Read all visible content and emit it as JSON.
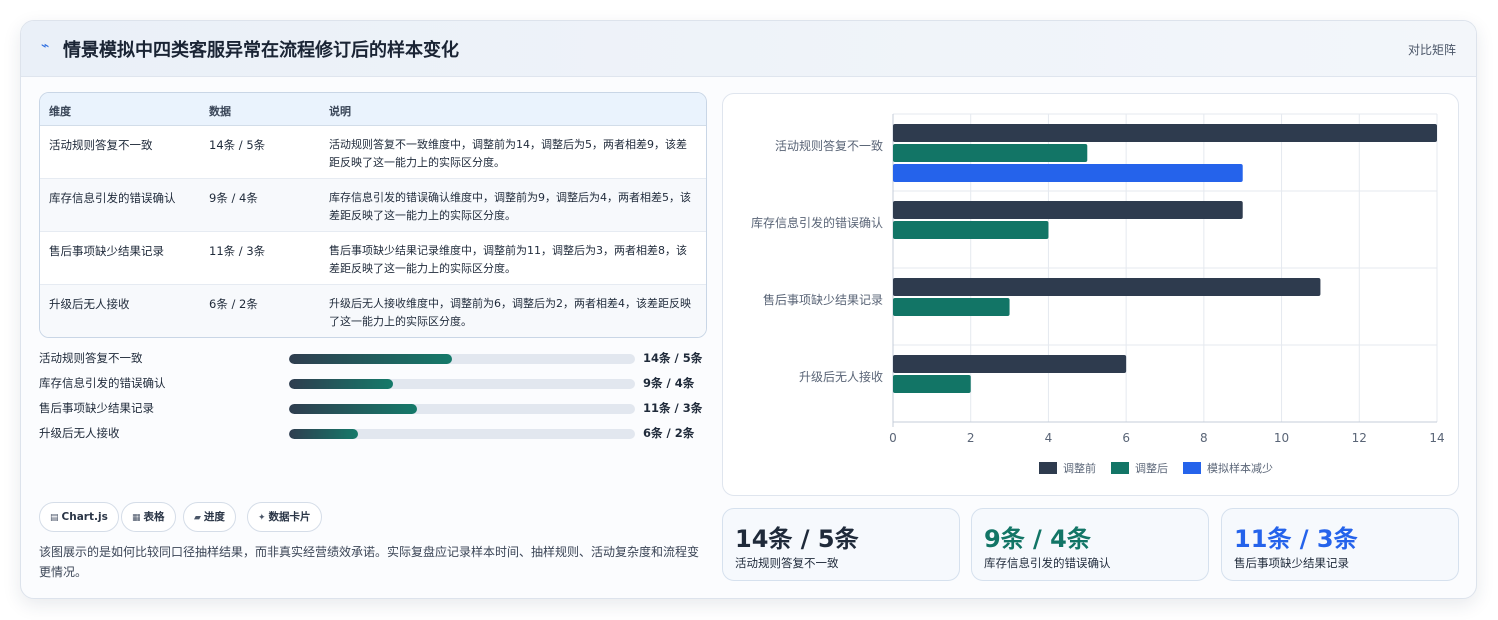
{
  "header": {
    "logo_glyph": "⌁",
    "title": "情景模拟中四类客服异常在流程修订后的样本变化",
    "compare_label": "对比矩阵"
  },
  "table": {
    "headers": [
      "维度",
      "数据",
      "说明"
    ],
    "rows": [
      {
        "dim": "活动规则答复不一致",
        "data": "14条 / 5条",
        "desc": "活动规则答复不一致维度中，调整前为14，调整后为5，两者相差9，该差距反映了这一能力上的实际区分度。"
      },
      {
        "dim": "库存信息引发的错误确认",
        "data": "9条 / 4条",
        "desc": "库存信息引发的错误确认维度中，调整前为9，调整后为4，两者相差5，该差距反映了这一能力上的实际区分度。"
      },
      {
        "dim": "售后事项缺少结果记录",
        "data": "11条 / 3条",
        "desc": "售后事项缺少结果记录维度中，调整前为11，调整后为3，两者相差8，该差距反映了这一能力上的实际区分度。"
      },
      {
        "dim": "升级后无人接收",
        "data": "6条 / 2条",
        "desc": "升级后无人接收维度中，调整前为6，调整后为2，两者相差4，该差距反映了这一能力上的实际区分度。"
      }
    ]
  },
  "progress": [
    {
      "label": "活动规则答复不一致",
      "value": "14条 / 5条",
      "fraction": 0.47
    },
    {
      "label": "库存信息引发的错误确认",
      "value": "9条 / 4条",
      "fraction": 0.3
    },
    {
      "label": "售后事项缺少结果记录",
      "value": "11条 / 3条",
      "fraction": 0.37
    },
    {
      "label": "升级后无人接收",
      "value": "6条 / 2条",
      "fraction": 0.2
    }
  ],
  "chips": [
    {
      "icon": "▤",
      "label": "Chart.js"
    },
    {
      "icon": "▦",
      "label": "表格"
    },
    {
      "icon": "▰",
      "label": "进度"
    },
    {
      "icon": "✦",
      "label": "数据卡片"
    }
  ],
  "footnote": "该图展示的是如何比较同口径抽样结果，而非真实经营绩效承诺。实际复盘应记录样本时间、抽样规则、活动复杂度和流程变更情况。",
  "chart_data": {
    "type": "bar",
    "orientation": "horizontal",
    "categories": [
      "活动规则答复不一致",
      "库存信息引发的错误确认",
      "售后事项缺少结果记录",
      "升级后无人接收"
    ],
    "series": [
      {
        "name": "调整前",
        "color": "#2e3b4e",
        "values": [
          14,
          9,
          11,
          6
        ]
      },
      {
        "name": "调整后",
        "color": "#127566",
        "values": [
          5,
          4,
          3,
          2
        ]
      },
      {
        "name": "模拟样本减少",
        "color": "#2563eb",
        "values": [
          9,
          null,
          null,
          null
        ]
      }
    ],
    "xlim": [
      0,
      14
    ],
    "xticks": [
      "0",
      "2",
      "4",
      "6",
      "8",
      "10",
      "12",
      "14"
    ],
    "grid": true,
    "legend_position": "bottom"
  },
  "stats": [
    {
      "value": "14条 / 5条",
      "label": "活动规则答复不一致",
      "color": "#1f2a3a"
    },
    {
      "value": "9条 / 4条",
      "label": "库存信息引发的错误确认",
      "color": "#127566"
    },
    {
      "value": "11条 / 3条",
      "label": "售后事项缺少结果记录",
      "color": "#2563eb"
    }
  ]
}
